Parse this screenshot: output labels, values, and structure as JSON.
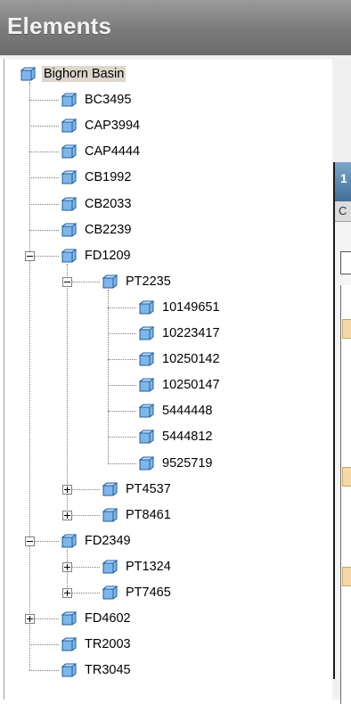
{
  "panel": {
    "title": "Elements"
  },
  "background_dialog": {
    "caption_char": "1",
    "tab_char": "C"
  },
  "tree": [
    {
      "label": "Bighorn Basin",
      "level": 0,
      "toggle": "none",
      "selected": true
    },
    {
      "label": "BC3495",
      "level": 1,
      "toggle": "none"
    },
    {
      "label": "CAP3994",
      "level": 1,
      "toggle": "none"
    },
    {
      "label": "CAP4444",
      "level": 1,
      "toggle": "none"
    },
    {
      "label": "CB1992",
      "level": 1,
      "toggle": "none"
    },
    {
      "label": "CB2033",
      "level": 1,
      "toggle": "none"
    },
    {
      "label": "CB2239",
      "level": 1,
      "toggle": "none"
    },
    {
      "label": "FD1209",
      "level": 1,
      "toggle": "minus"
    },
    {
      "label": "PT2235",
      "level": 2,
      "toggle": "minus"
    },
    {
      "label": "10149651",
      "level": 3,
      "toggle": "none"
    },
    {
      "label": "10223417",
      "level": 3,
      "toggle": "none"
    },
    {
      "label": "10250142",
      "level": 3,
      "toggle": "none"
    },
    {
      "label": "10250147",
      "level": 3,
      "toggle": "none"
    },
    {
      "label": "5444448",
      "level": 3,
      "toggle": "none"
    },
    {
      "label": "5444812",
      "level": 3,
      "toggle": "none"
    },
    {
      "label": "9525719",
      "level": 3,
      "toggle": "none"
    },
    {
      "label": "PT4537",
      "level": 2,
      "toggle": "plus"
    },
    {
      "label": "PT8461",
      "level": 2,
      "toggle": "plus"
    },
    {
      "label": "FD2349",
      "level": 1,
      "toggle": "minus"
    },
    {
      "label": "PT1324",
      "level": 2,
      "toggle": "plus"
    },
    {
      "label": "PT7465",
      "level": 2,
      "toggle": "plus"
    },
    {
      "label": "FD4602",
      "level": 1,
      "toggle": "plus"
    },
    {
      "label": "TR2003",
      "level": 1,
      "toggle": "none"
    },
    {
      "label": "TR3045",
      "level": 1,
      "toggle": "none"
    }
  ],
  "colors": {
    "cube_face": "#7fb6ea",
    "cube_top": "#c6e2ff",
    "cube_edge": "#1f5e9c",
    "selection": "#dcd6cc"
  },
  "icons": {
    "node": "cube-icon",
    "expand": "plus-box-icon",
    "collapse": "minus-box-icon"
  }
}
